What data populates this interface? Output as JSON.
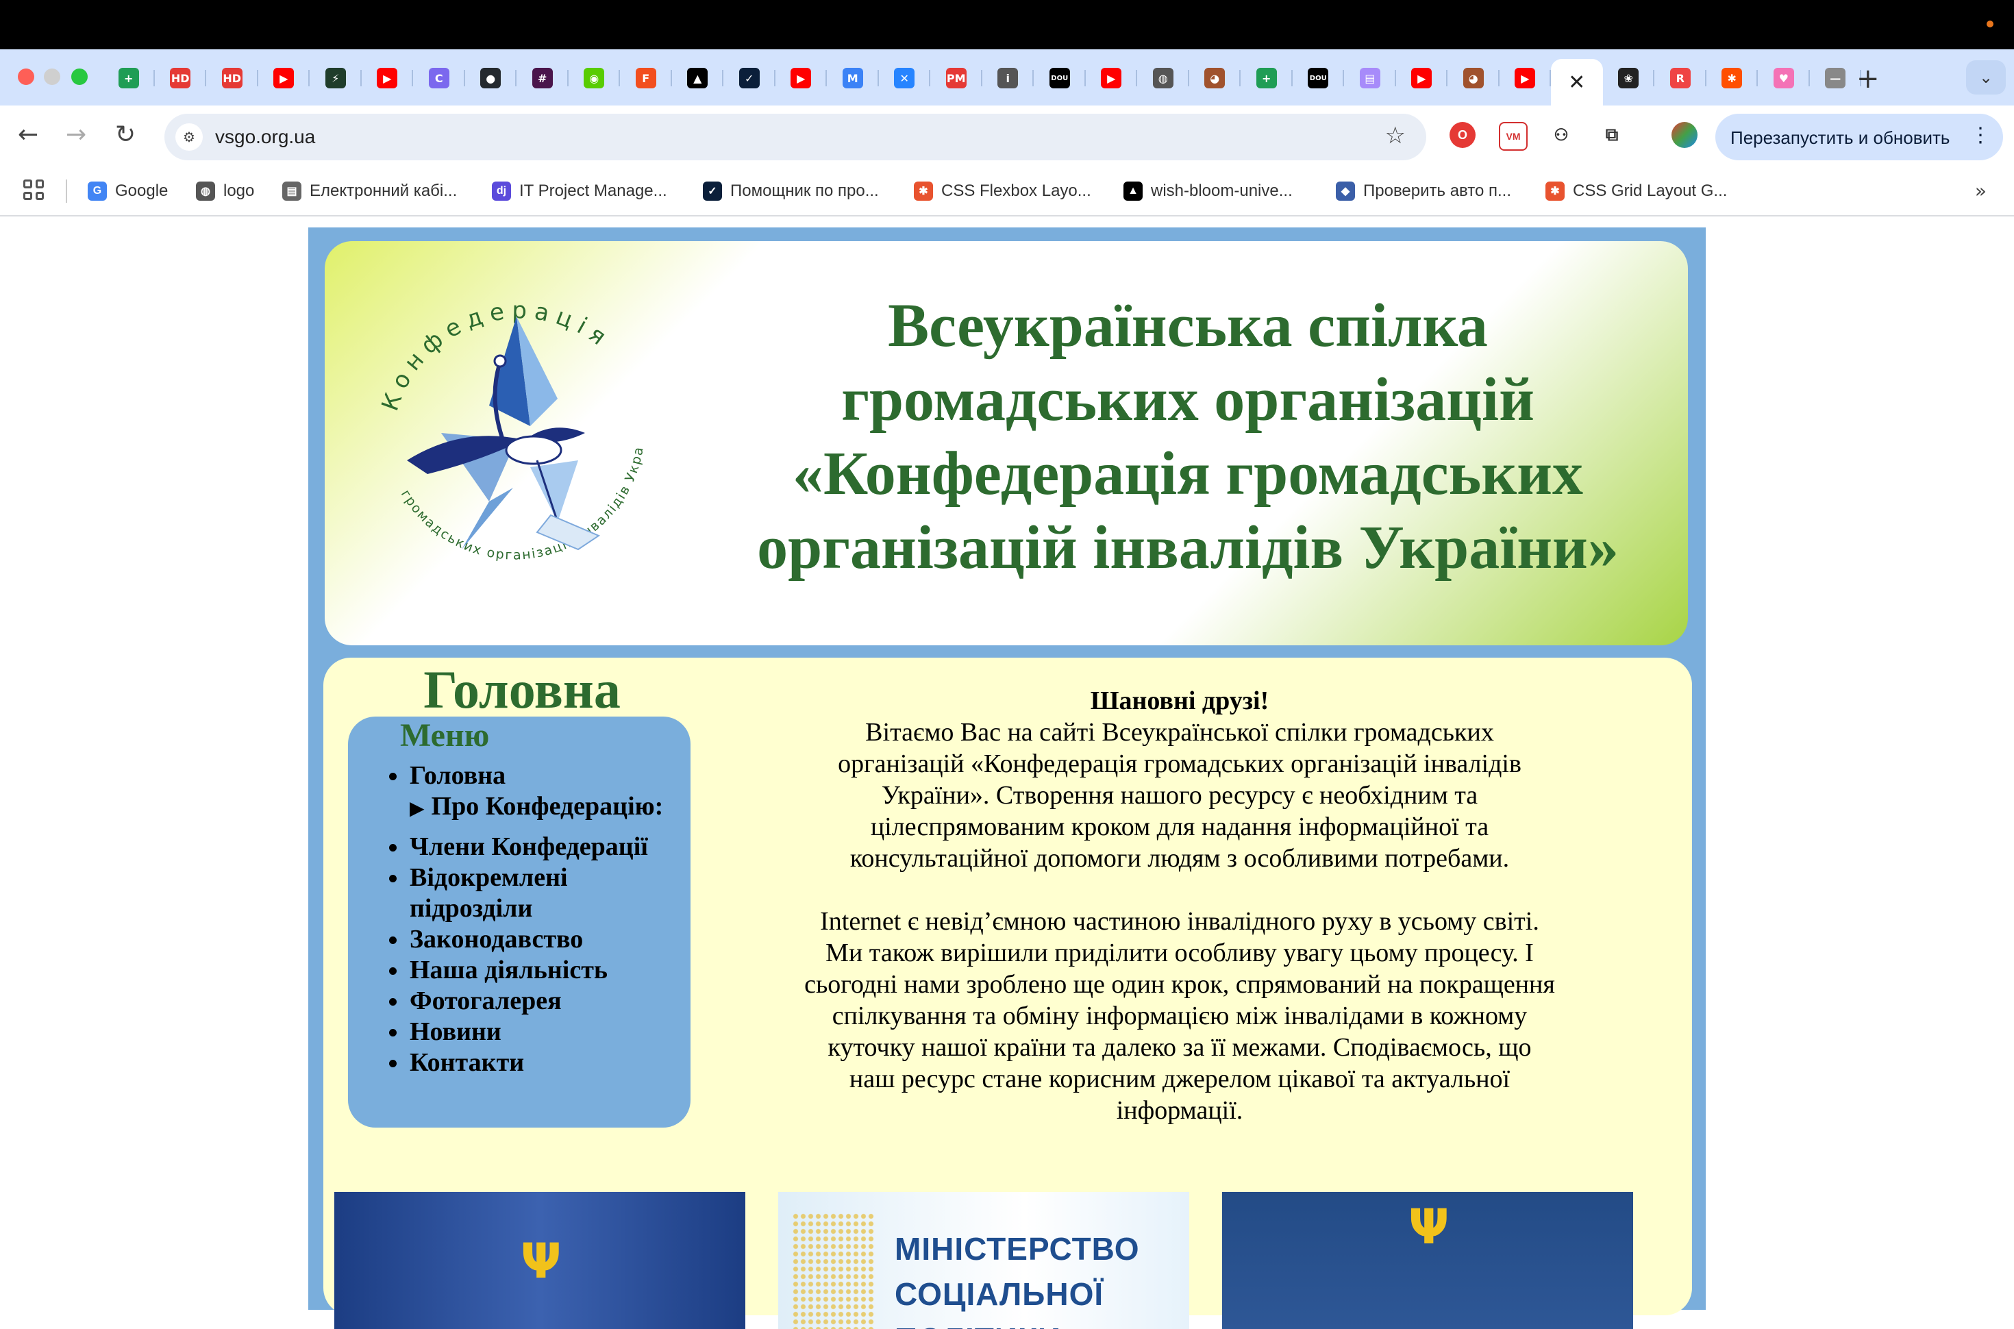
{
  "browser": {
    "url": "vsgo.org.ua",
    "relaunch_label": "Перезапустить и обновить",
    "tabs": [
      {
        "icon": "plus-green-icon",
        "color": "#1f9d55",
        "glyph": "+"
      },
      {
        "icon": "hd-icon",
        "color": "#e53935",
        "glyph": "HD"
      },
      {
        "icon": "hd-icon",
        "color": "#e53935",
        "glyph": "HD"
      },
      {
        "icon": "youtube-icon",
        "color": "#ff0000",
        "glyph": "▶"
      },
      {
        "icon": "bolt-icon",
        "color": "#1f3d2b",
        "glyph": "⚡"
      },
      {
        "icon": "youtube-icon",
        "color": "#ff0000",
        "glyph": "▶"
      },
      {
        "icon": "clickup-icon",
        "color": "#7b68ee",
        "glyph": "C"
      },
      {
        "icon": "github-icon",
        "color": "#24292e",
        "glyph": "●"
      },
      {
        "icon": "slack-icon",
        "color": "#4a154b",
        "glyph": "#"
      },
      {
        "icon": "owl-icon",
        "color": "#58cc02",
        "glyph": "◉"
      },
      {
        "icon": "figma-icon",
        "color": "#f24e1e",
        "glyph": "F"
      },
      {
        "icon": "triangle-icon",
        "color": "#000000",
        "glyph": "▲"
      },
      {
        "icon": "check-icon",
        "color": "#0b1f3a",
        "glyph": "✓"
      },
      {
        "icon": "youtube-icon",
        "color": "#ff0000",
        "glyph": "▶"
      },
      {
        "icon": "mj-icon",
        "color": "#3b82f6",
        "glyph": "M"
      },
      {
        "icon": "jira-icon",
        "color": "#2684ff",
        "glyph": "✕"
      },
      {
        "icon": "pm-icon",
        "color": "#e53935",
        "glyph": "PM"
      },
      {
        "icon": "info-icon",
        "color": "#555555",
        "glyph": "i"
      },
      {
        "icon": "dou-icon",
        "color": "#000000",
        "glyph": "DOU"
      },
      {
        "icon": "youtube-icon",
        "color": "#ff0000",
        "glyph": "▶"
      },
      {
        "icon": "globe-icon",
        "color": "#555555",
        "glyph": "◍"
      },
      {
        "icon": "monkey-icon",
        "color": "#a0522d",
        "glyph": "◕"
      },
      {
        "icon": "plus-green-icon",
        "color": "#1f9d55",
        "glyph": "+"
      },
      {
        "icon": "dou-icon",
        "color": "#000000",
        "glyph": "DOU"
      },
      {
        "icon": "doc-icon",
        "color": "#a78bfa",
        "glyph": "▤"
      },
      {
        "icon": "youtube-icon",
        "color": "#ff0000",
        "glyph": "▶"
      },
      {
        "icon": "monkey-icon",
        "color": "#a0522d",
        "glyph": "◕"
      },
      {
        "icon": "youtube-icon",
        "color": "#ff0000",
        "glyph": "▶"
      },
      {
        "icon": "close-icon",
        "color": "#ffffff",
        "glyph": "✕",
        "active": true
      },
      {
        "icon": "openai-icon",
        "color": "#222222",
        "glyph": "❀"
      },
      {
        "icon": "r-icon",
        "color": "#ef4444",
        "glyph": "R"
      },
      {
        "icon": "zapier-icon",
        "color": "#ff4f00",
        "glyph": "✱"
      },
      {
        "icon": "heart-icon",
        "color": "#f472b6",
        "glyph": "♥"
      },
      {
        "icon": "line-icon",
        "color": "#888888",
        "glyph": "—"
      }
    ],
    "bookmarks": [
      {
        "label": "Google",
        "icon": "google-icon",
        "color": "#4285f4",
        "glyph": "G"
      },
      {
        "label": "logo",
        "icon": "globe-icon",
        "color": "#555555",
        "glyph": "◍"
      },
      {
        "label": "Електронний кабі...",
        "icon": "doc-icon",
        "color": "#666666",
        "glyph": "▤"
      },
      {
        "label": "IT Project Manage...",
        "icon": "dj-icon",
        "color": "#5b4bdb",
        "glyph": "dj"
      },
      {
        "label": "Помощник по про...",
        "icon": "check-icon",
        "color": "#0b1f3a",
        "glyph": "✓"
      },
      {
        "label": "CSS Flexbox Layo...",
        "icon": "asterisk-icon",
        "color": "#e8532f",
        "glyph": "✱"
      },
      {
        "label": "wish-bloom-unive...",
        "icon": "triangle-icon",
        "color": "#000000",
        "glyph": "▲"
      },
      {
        "label": "Проверить авто п...",
        "icon": "shield-icon",
        "color": "#3b5fa8",
        "glyph": "◆"
      },
      {
        "label": "CSS Grid Layout G...",
        "icon": "asterisk-icon",
        "color": "#e8532f",
        "glyph": "✱"
      }
    ]
  },
  "site": {
    "title_lines": [
      "Всеукраїнська спілка",
      "громадських організацій",
      "«Конфедерація громадських",
      "організацій інвалідів України»"
    ],
    "logo_top_text": "Конфедерація",
    "logo_bottom_text": "громадських організацій інвалідів України",
    "page_heading": "Головна",
    "menu_title": "Меню",
    "menu": [
      {
        "label": "Головна",
        "type": "bullet"
      },
      {
        "label": "Про Конфедерацію:",
        "type": "sub"
      },
      {
        "label": "Члени Конфедерації",
        "type": "bullet"
      },
      {
        "label": "Відокремлені підрозділи",
        "type": "bullet"
      },
      {
        "label": "Законодавство",
        "type": "bullet"
      },
      {
        "label": "Наша діяльність",
        "type": "bullet"
      },
      {
        "label": "Фотогалерея",
        "type": "bullet"
      },
      {
        "label": "Новини",
        "type": "bullet"
      },
      {
        "label": "Контакти",
        "type": "bullet"
      }
    ],
    "greeting": "Шановні друзі!",
    "para1": "Вітаємо Вас на сайті Всеукраїнської спілки громадських організацій «Конфедерація громадських організацій інвалідів України». Створення нашого ресурсу є необхідним та цілеспрямованим кроком для надання інформаційної та консультаційної допомоги людям з особливими потребами.",
    "para2": "Internet є невід’ємною частиною інвалідного руху в усьому світі. Ми також вирішили приділити особливу увагу цьому процесу. І сьогодні нами зроблено ще один крок, спрямований на покращення спілкування та обміну інформацією між інвалідами в кожному куточку нашої країни та далеко за її межами. Сподіваємось, що наш ресурс стане корисним джерелом цікавої та актуальної інформації.",
    "banner2_line1": "МІНІСТЕРСТВО",
    "banner2_line2": "СОЦІАЛЬНОЇ ПОЛІТИКИ",
    "colors": {
      "header_green": "#2d6b2f",
      "site_blue": "#7aaedc",
      "content_bg": "#ffffd0"
    }
  }
}
